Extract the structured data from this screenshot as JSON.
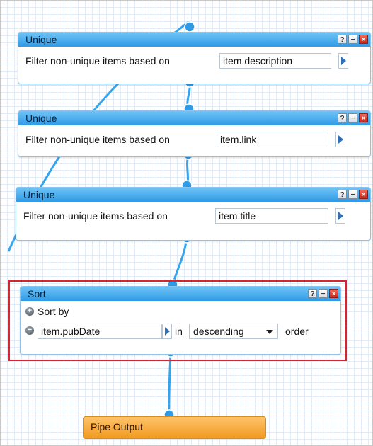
{
  "modules": [
    {
      "title": "Unique",
      "label": "Filter non-unique items based on",
      "field_value": "item.description"
    },
    {
      "title": "Unique",
      "label": "Filter non-unique items based on",
      "field_value": "item.link"
    },
    {
      "title": "Unique",
      "label": "Filter non-unique items based on",
      "field_value": "item.title"
    }
  ],
  "sort": {
    "title": "Sort",
    "sort_by_label": "Sort by",
    "field_value": "item.pubDate",
    "in_label": "in",
    "order_value": "descending",
    "order_label": "order"
  },
  "output": {
    "title": "Pipe Output"
  },
  "controls": {
    "help": "?",
    "minimize": "−",
    "close": "×"
  },
  "colors": {
    "module_title": "#2f9ae6",
    "wire": "#33a4ee",
    "selection": "#d9232e",
    "output": "#f19a20"
  }
}
